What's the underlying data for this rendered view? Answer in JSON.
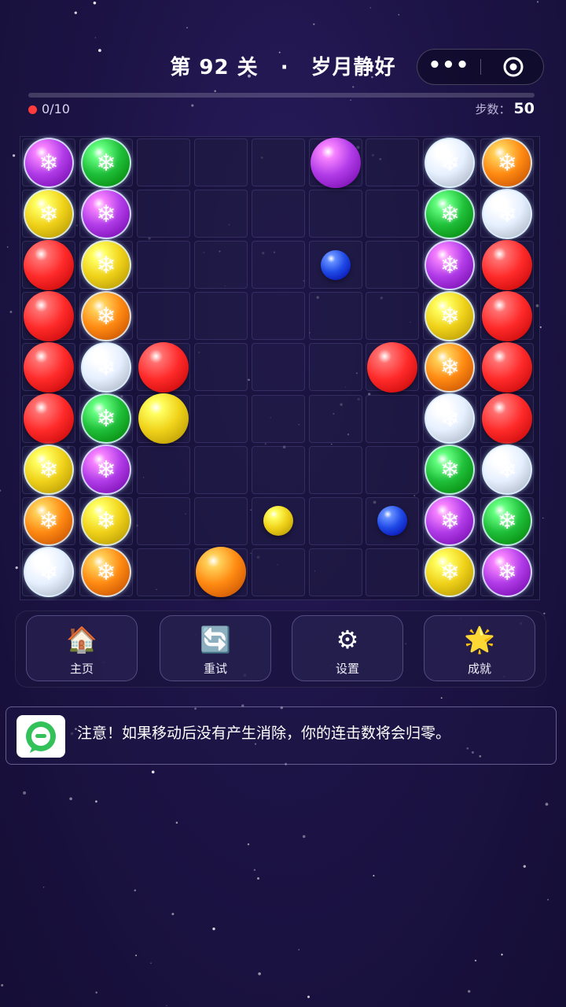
{
  "header": {
    "level_prefix": "第",
    "level_number": "92",
    "level_suffix": "关",
    "separator": "·",
    "level_name": "岁月静好",
    "more_label": "•••"
  },
  "status": {
    "goal_text": "0/10",
    "goal_progress": 0.0,
    "steps_label": "步数：",
    "steps_value": "50"
  },
  "board": {
    "rows": 9,
    "cols": 9,
    "colors": {
      "red": "#ff2a2a",
      "green": "#1fbf3a",
      "purple": "#b13ce8",
      "yellow": "#f0d21a",
      "orange": "#ff8a12",
      "white": "#e6f0ff",
      "blue": "#1f49e6"
    },
    "balls": [
      {
        "row": 0,
        "col": 0,
        "color": "purple",
        "state": "frozen"
      },
      {
        "row": 0,
        "col": 1,
        "color": "green",
        "state": "frozen"
      },
      {
        "row": 0,
        "col": 5,
        "color": "purple",
        "state": "full"
      },
      {
        "row": 0,
        "col": 7,
        "color": "white",
        "state": "frozen"
      },
      {
        "row": 0,
        "col": 8,
        "color": "orange",
        "state": "frozen"
      },
      {
        "row": 1,
        "col": 0,
        "color": "yellow",
        "state": "frozen"
      },
      {
        "row": 1,
        "col": 1,
        "color": "purple",
        "state": "frozen"
      },
      {
        "row": 1,
        "col": 7,
        "color": "green",
        "state": "frozen"
      },
      {
        "row": 1,
        "col": 8,
        "color": "white",
        "state": "frozen"
      },
      {
        "row": 2,
        "col": 0,
        "color": "red",
        "state": "full"
      },
      {
        "row": 2,
        "col": 1,
        "color": "yellow",
        "state": "frozen"
      },
      {
        "row": 2,
        "col": 5,
        "color": "blue",
        "state": "small"
      },
      {
        "row": 2,
        "col": 7,
        "color": "purple",
        "state": "frozen"
      },
      {
        "row": 2,
        "col": 8,
        "color": "red",
        "state": "full"
      },
      {
        "row": 3,
        "col": 0,
        "color": "red",
        "state": "full"
      },
      {
        "row": 3,
        "col": 1,
        "color": "orange",
        "state": "frozen"
      },
      {
        "row": 3,
        "col": 7,
        "color": "yellow",
        "state": "frozen"
      },
      {
        "row": 3,
        "col": 8,
        "color": "red",
        "state": "full"
      },
      {
        "row": 4,
        "col": 0,
        "color": "red",
        "state": "full"
      },
      {
        "row": 4,
        "col": 1,
        "color": "white",
        "state": "frozen"
      },
      {
        "row": 4,
        "col": 2,
        "color": "red",
        "state": "full"
      },
      {
        "row": 4,
        "col": 6,
        "color": "red",
        "state": "full"
      },
      {
        "row": 4,
        "col": 7,
        "color": "orange",
        "state": "frozen"
      },
      {
        "row": 4,
        "col": 8,
        "color": "red",
        "state": "full"
      },
      {
        "row": 5,
        "col": 0,
        "color": "red",
        "state": "full"
      },
      {
        "row": 5,
        "col": 1,
        "color": "green",
        "state": "frozen"
      },
      {
        "row": 5,
        "col": 2,
        "color": "yellow",
        "state": "full"
      },
      {
        "row": 5,
        "col": 7,
        "color": "white",
        "state": "frozen"
      },
      {
        "row": 5,
        "col": 8,
        "color": "red",
        "state": "full"
      },
      {
        "row": 6,
        "col": 0,
        "color": "yellow",
        "state": "frozen"
      },
      {
        "row": 6,
        "col": 1,
        "color": "purple",
        "state": "frozen"
      },
      {
        "row": 6,
        "col": 7,
        "color": "green",
        "state": "frozen"
      },
      {
        "row": 6,
        "col": 8,
        "color": "white",
        "state": "frozen"
      },
      {
        "row": 7,
        "col": 0,
        "color": "orange",
        "state": "frozen"
      },
      {
        "row": 7,
        "col": 1,
        "color": "yellow",
        "state": "frozen"
      },
      {
        "row": 7,
        "col": 4,
        "color": "yellow",
        "state": "small"
      },
      {
        "row": 7,
        "col": 6,
        "color": "blue",
        "state": "small"
      },
      {
        "row": 7,
        "col": 7,
        "color": "purple",
        "state": "frozen"
      },
      {
        "row": 7,
        "col": 8,
        "color": "green",
        "state": "frozen"
      },
      {
        "row": 8,
        "col": 0,
        "color": "white",
        "state": "frozen"
      },
      {
        "row": 8,
        "col": 1,
        "color": "orange",
        "state": "frozen"
      },
      {
        "row": 8,
        "col": 3,
        "color": "orange",
        "state": "full"
      },
      {
        "row": 8,
        "col": 7,
        "color": "yellow",
        "state": "frozen"
      },
      {
        "row": 8,
        "col": 8,
        "color": "purple",
        "state": "frozen"
      }
    ]
  },
  "toolbar": {
    "home": {
      "icon": "🏠",
      "label": "主页",
      "icon_name": "house-icon"
    },
    "retry": {
      "icon": "🔄",
      "label": "重试",
      "icon_name": "refresh-icon"
    },
    "settings": {
      "icon": "⚙",
      "label": "设置",
      "icon_name": "gear-icon"
    },
    "achievements": {
      "icon": "🌟",
      "label": "成就",
      "icon_name": "star-icon"
    }
  },
  "notice": {
    "icon_name": "chat-bubble-icon",
    "text": "注意！如果移动后没有产生消除，你的连击数将会归零。"
  }
}
